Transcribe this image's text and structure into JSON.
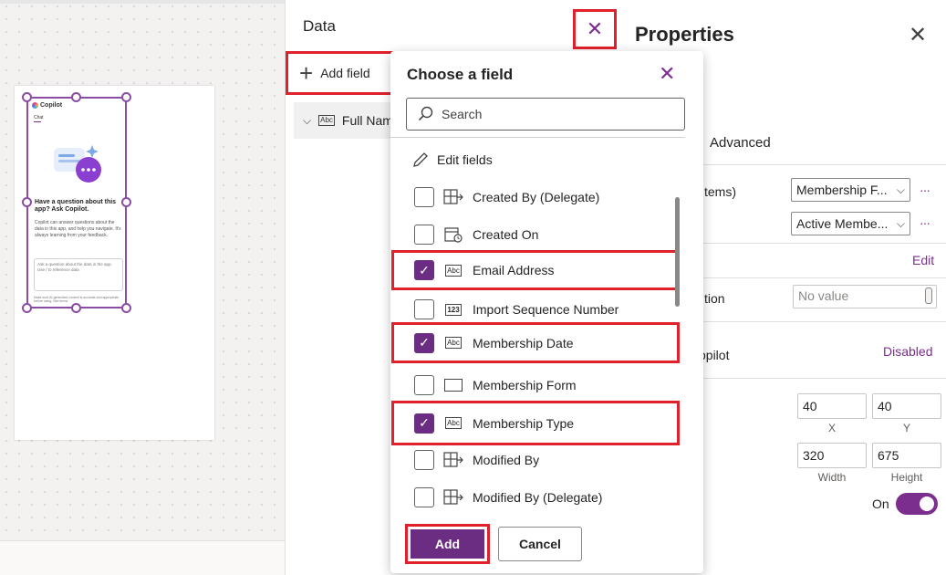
{
  "canvas": {
    "copilot": {
      "name": "Copilot",
      "tab": "Chat",
      "title": "Have a question about this app? Ask Copilot.",
      "description": "Copilot can answer questions about the data in this app, and help you navigate. It's always learning from your feedback.",
      "input_placeholder": "Ask a question about the data in the app. Use / to reference data",
      "footer": "Make sure AI-generated content is accurate and appropriate before using. See terms"
    }
  },
  "data_panel": {
    "title": "Data",
    "add_field_label": "Add field",
    "field_row_label": "Full Nam"
  },
  "chooser": {
    "title": "Choose a field",
    "search_placeholder": "Search",
    "edit_fields_label": "Edit fields",
    "fields": [
      {
        "label": "Created By (Delegate)",
        "icon": "lookup-icon",
        "checked": false
      },
      {
        "label": "Created On",
        "icon": "calendar-icon",
        "checked": false
      },
      {
        "label": "Email Address",
        "icon": "text-icon",
        "checked": true
      },
      {
        "label": "Import Sequence Number",
        "icon": "number-icon",
        "checked": false
      },
      {
        "label": "Membership Date",
        "icon": "text-icon",
        "checked": true
      },
      {
        "label": "Membership Form",
        "icon": "form-icon",
        "checked": false
      },
      {
        "label": "Membership Type",
        "icon": "text-icon",
        "checked": true
      },
      {
        "label": "Modified By",
        "icon": "lookup-icon",
        "checked": false
      },
      {
        "label": "Modified By (Delegate)",
        "icon": "lookup-icon",
        "checked": false
      }
    ],
    "add_label": "Add",
    "cancel_label": "Cancel"
  },
  "properties": {
    "title": "Properties",
    "tab_advanced": "Advanced",
    "items_label": "tems)",
    "items_value": "Membership F...",
    "view_value": "Active Membe...",
    "edit_link": "Edit",
    "ation_label": "tion",
    "no_value_placeholder": "No value",
    "copilot_label": "opilot",
    "copilot_status": "Disabled",
    "x_value": "40",
    "y_value": "40",
    "x_caption": "X",
    "y_caption": "Y",
    "width_value": "320",
    "height_value": "675",
    "width_caption": "Width",
    "height_caption": "Height",
    "toggle_label": "On"
  },
  "colors": {
    "accent": "#6b2d82",
    "highlight": "#e0202a",
    "selection": "#8a4ca4"
  }
}
